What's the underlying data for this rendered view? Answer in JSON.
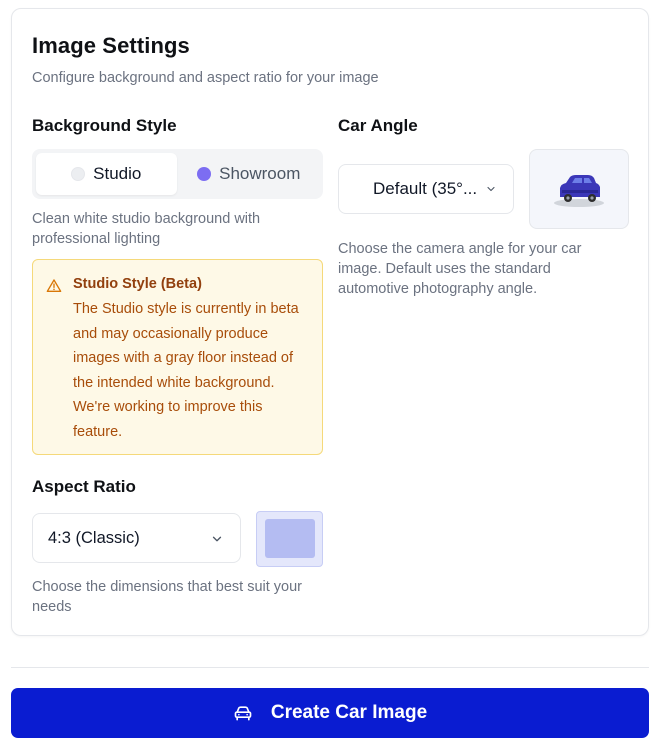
{
  "settings": {
    "title": "Image Settings",
    "subtitle": "Configure background and aspect ratio for your image"
  },
  "background_style": {
    "label": "Background Style",
    "options": [
      {
        "label": "Studio",
        "selected": true,
        "dot_color": "#eceef1"
      },
      {
        "label": "Showroom",
        "selected": false,
        "dot_color": "#7c6df2"
      }
    ],
    "help": "Clean white studio background with professional lighting",
    "warning": {
      "icon": "warning-triangle-icon",
      "title": "Studio Style (Beta)",
      "body": "The Studio style is currently in beta and may occasionally produce images with a gray floor instead of the intended white background. We're working to improve this feature."
    }
  },
  "aspect_ratio": {
    "label": "Aspect Ratio",
    "value": "4:3 (Classic)",
    "help": "Choose the dimensions that best suit your needs"
  },
  "car_angle": {
    "label": "Car Angle",
    "value": "Default (35°...",
    "help": "Choose the camera angle for your car image. Default uses the standard automotive photography angle.",
    "preview_icon": "car-icon"
  },
  "cta": {
    "label": "Create Car Image",
    "icon": "car-front-icon",
    "color": "#0a1cd1"
  },
  "colors": {
    "accent": "#0a1cd1",
    "warning_bg": "#fef9e7",
    "warning_text": "#a84d0a",
    "showroom_dot": "#7c6df2"
  }
}
